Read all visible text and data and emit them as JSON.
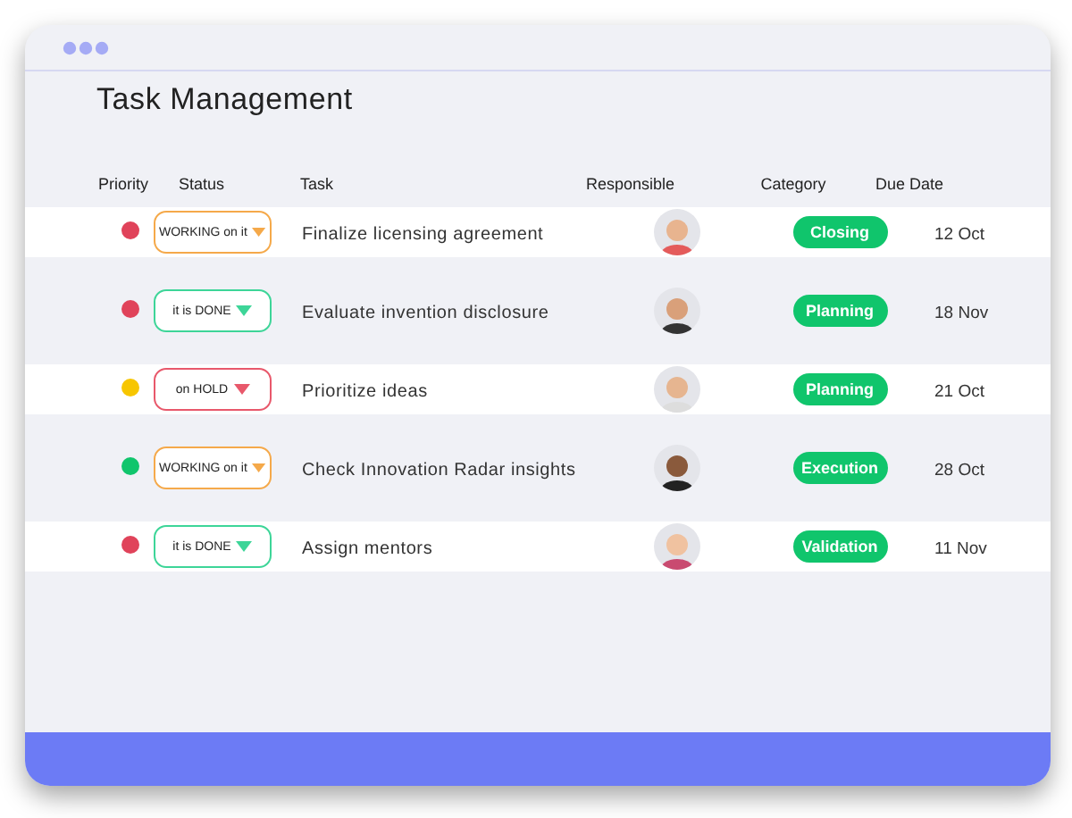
{
  "window": {
    "title": "Task Management"
  },
  "table": {
    "columns": [
      "Priority",
      "Status",
      "Task",
      "Responsible",
      "Category",
      "Due Date"
    ],
    "rows": [
      {
        "color": "#e0435a",
        "status": {
          "kind": "working",
          "label": "WORKING on it"
        },
        "task": "Finalize licensing agreement",
        "category": "Closing",
        "due": "12 Oct"
      },
      {
        "color": "#e0435a",
        "status": {
          "kind": "done",
          "label": "it is DONE"
        },
        "task": "Evaluate invention disclosure",
        "category": "Planning",
        "due": "18 Nov"
      },
      {
        "color": "#f7c600",
        "status": {
          "kind": "hold",
          "label": "on HOLD"
        },
        "task": "Prioritize ideas",
        "category": "Planning",
        "due": "21 Oct"
      },
      {
        "color": "#10c56c",
        "status": {
          "kind": "working",
          "label": "WORKING on it"
        },
        "task": "Check Innovation Radar insights",
        "category": "Execution",
        "due": "28 Oct"
      },
      {
        "color": "#e0435a",
        "status": {
          "kind": "done",
          "label": "it is DONE"
        },
        "task": "Assign mentors",
        "category": "Validation",
        "due": "11 Nov"
      }
    ]
  }
}
